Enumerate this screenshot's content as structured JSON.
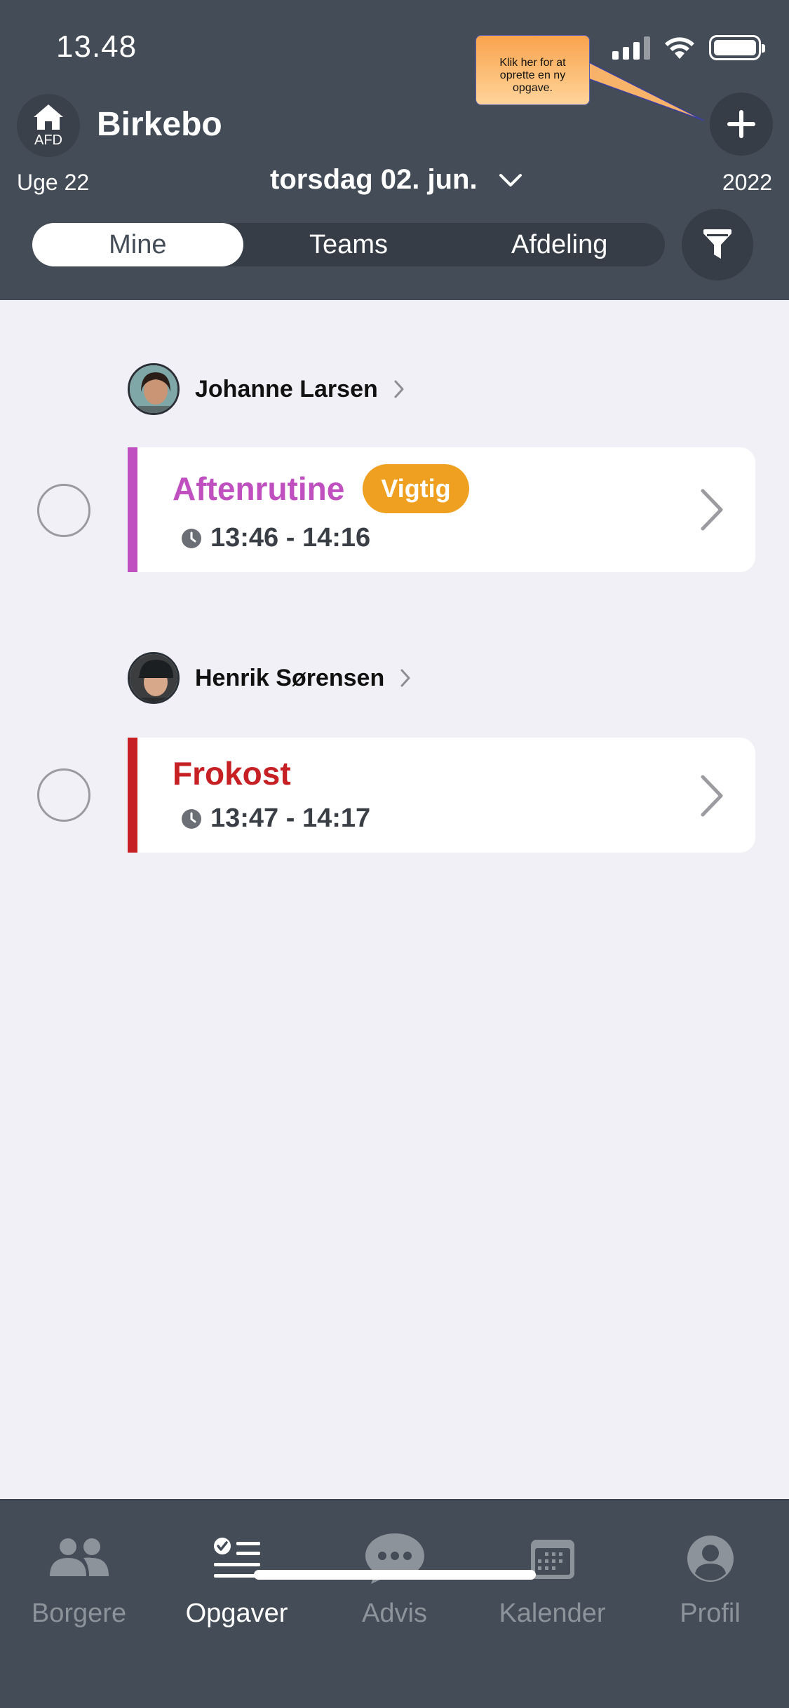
{
  "status_bar": {
    "time": "13.48"
  },
  "header": {
    "home_sub_label": "AFD",
    "ward_name": "Birkebo",
    "week": "Uge 22",
    "date": "torsdag 02. jun.",
    "year": "2022",
    "tooltip": "Klik her for at oprette en ny opgave."
  },
  "segments": [
    {
      "label": "Mine",
      "active": true
    },
    {
      "label": "Teams",
      "active": false
    },
    {
      "label": "Afdeling",
      "active": false
    }
  ],
  "groups": [
    {
      "person": "Johanne Larsen",
      "task": {
        "title": "Aftenrutine",
        "badge": "Vigtig",
        "time": "13:46 - 14:16",
        "color": "#C050C0"
      }
    },
    {
      "person": "Henrik Sørensen",
      "task": {
        "title": "Frokost",
        "badge": "",
        "time": "13:47 - 14:17",
        "color": "#C61F24"
      }
    }
  ],
  "tabbar": [
    {
      "label": "Borgere",
      "icon": "people-icon",
      "active": false
    },
    {
      "label": "Opgaver",
      "icon": "task-list-icon",
      "active": true
    },
    {
      "label": "Advis",
      "icon": "chat-bubble-icon",
      "active": false
    },
    {
      "label": "Kalender",
      "icon": "calendar-icon",
      "active": false
    },
    {
      "label": "Profil",
      "icon": "profile-icon",
      "active": false
    }
  ],
  "colors": {
    "header_bg": "#434C57",
    "page_bg": "#F1F0F7",
    "badge": "#F0A020",
    "tooltip": "#F9A34D"
  }
}
